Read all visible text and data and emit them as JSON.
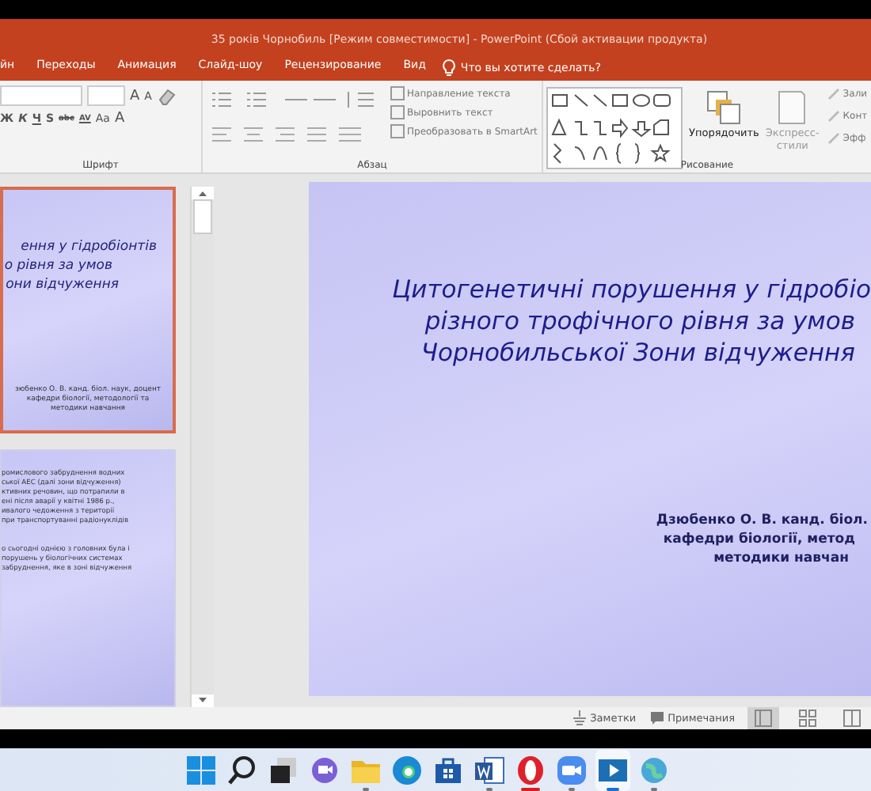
{
  "window": {
    "title": "35 років Чорнобиль [Режим совместимости] - PowerPoint (Сбой активации продукта)"
  },
  "menu_tabs": [
    {
      "label": "йн"
    },
    {
      "label": "Переходы"
    },
    {
      "label": "Анимация"
    },
    {
      "label": "Слайд-шоу"
    },
    {
      "label": "Рецензирование"
    },
    {
      "label": "Вид"
    }
  ],
  "tell_me": {
    "placeholder": "Что вы хотите сделать?"
  },
  "ribbon": {
    "font": {
      "label": "Шрифт",
      "grow": "A",
      "shrink": "A",
      "format_buttons": [
        "Ж",
        "К",
        "Ч",
        "S",
        "abc",
        "AV",
        "Aa",
        "A"
      ]
    },
    "paragraph": {
      "label": "Абзац",
      "commands": [
        "Направление текста",
        "Выровнить текст",
        "Преобразовать в SmartArt"
      ]
    },
    "drawing": {
      "label": "Рисование",
      "arrange": "Упорядочить",
      "quick_styles": [
        "Экспресс-",
        "стили"
      ],
      "commands": [
        "Зали",
        "Конт",
        "Эфф"
      ]
    }
  },
  "thumbnails": [
    {
      "kind": "title",
      "selected": true,
      "title_lines": [
        "ення у гідробіонтів",
        "о рівня за умов",
        "они відчуження"
      ],
      "subtitle_lines": [
        "зюбенко О. В. канд. біол. наук, доцент",
        "кафедри біології, методології та",
        "методики навчання"
      ]
    },
    {
      "kind": "text",
      "selected": false,
      "paragraphs": [
        [
          "ромислового забруднення водних",
          "ської АЕС (далі зони відчуження)",
          "ктивних речовин, що потрапили в",
          "ені після аварії у квітні 1986 р.,",
          "ивалого чедоження з території",
          "при транспортуванні радіонуклідів"
        ],
        [
          "о сьогодні однією з головних була і",
          "порушень у біологічних системах",
          "забруднення, яке в зоні відчуження"
        ]
      ]
    }
  ],
  "slide": {
    "title_lines": [
      "Цитогенетичні порушення у гідробіо",
      "різного трофічного рівня за умов",
      "Чорнобильської Зони відчуження"
    ],
    "author_lines": [
      "Дзюбенко О. В. канд. біол.",
      "кафедри біології, метод",
      "методики навчан"
    ]
  },
  "status_bar": {
    "notes": "Заметки",
    "comments": "Примечания",
    "views": [
      {
        "kind": "normal",
        "selected": true
      },
      {
        "kind": "sorter",
        "selected": false
      },
      {
        "kind": "reading",
        "selected": false
      }
    ]
  },
  "taskbar": [
    {
      "kind": "start",
      "active": false,
      "running": false
    },
    {
      "kind": "search",
      "active": false,
      "running": false
    },
    {
      "kind": "taskview",
      "active": false,
      "running": false
    },
    {
      "kind": "chat",
      "active": false,
      "running": false
    },
    {
      "kind": "explorer",
      "active": false,
      "running": true
    },
    {
      "kind": "edge",
      "active": false,
      "running": false
    },
    {
      "kind": "store",
      "active": false,
      "running": false
    },
    {
      "kind": "word",
      "active": false,
      "running": true
    },
    {
      "kind": "opera",
      "active": false,
      "running": true
    },
    {
      "kind": "zoom",
      "active": false,
      "running": true
    },
    {
      "kind": "powerpoint",
      "active": true,
      "running": true
    },
    {
      "kind": "network",
      "active": false,
      "running": true
    }
  ]
}
